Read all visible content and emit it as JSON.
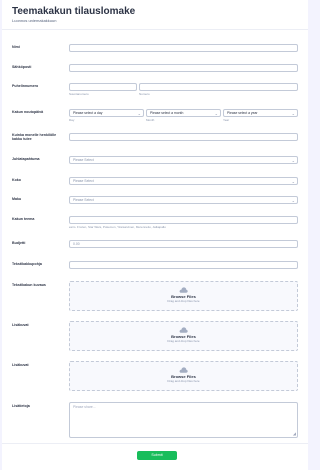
{
  "form": {
    "title": "Teemakakun tilauslomake",
    "subtitle": "Luonnos uniemakakkuun"
  },
  "fields": {
    "nimi": {
      "label": "Nimi"
    },
    "email": {
      "label": "Sähköposti"
    },
    "phone": {
      "label": "Puhelinnumero",
      "area_sub": "Suuntanumero",
      "number_sub": "Numero"
    },
    "date": {
      "label": "Kakun noutopäivä",
      "day_placeholder": "Please select a day",
      "month_placeholder": "Please select a month",
      "year_placeholder": "Please select a year",
      "day_sub": "Day",
      "month_sub": "Month",
      "year_sub": "Year"
    },
    "guests": {
      "label": "Kuinka monelle henkilölle kakku tulee"
    },
    "occasion": {
      "label": "Juhlatapahtuma",
      "placeholder": "Please Select"
    },
    "size": {
      "label": "Koko",
      "placeholder": "Please Select"
    },
    "flavor": {
      "label": "Maku",
      "placeholder": "Please Select"
    },
    "theme": {
      "label": "Kakun teema",
      "sub": "esim. Frozen, Star Wars, Pokemon, Yksisarvinen, Merenneito, Jalkapallo"
    },
    "budget": {
      "label": "Budjetti",
      "placeholder": "0.00"
    },
    "inscription": {
      "label": "Tekstikakkupohja"
    },
    "upload1": {
      "label": "Tekstikakun kuvaus",
      "title": "Browse Files",
      "sub": "Drag and drop files here"
    },
    "upload2": {
      "label": "Lisäkuvat",
      "title": "Browse Files",
      "sub": "Drag and drop files here"
    },
    "upload3": {
      "label": "Lisäkuvat",
      "title": "Browse Files",
      "sub": "Drag and drop files here"
    },
    "notes": {
      "label": "Lisätietoja",
      "placeholder": "Please share..."
    }
  },
  "submit_label": "Submit",
  "colors": {
    "accent": "#18bd5b",
    "background": "#f3f3fe",
    "border": "#c3cad8"
  }
}
